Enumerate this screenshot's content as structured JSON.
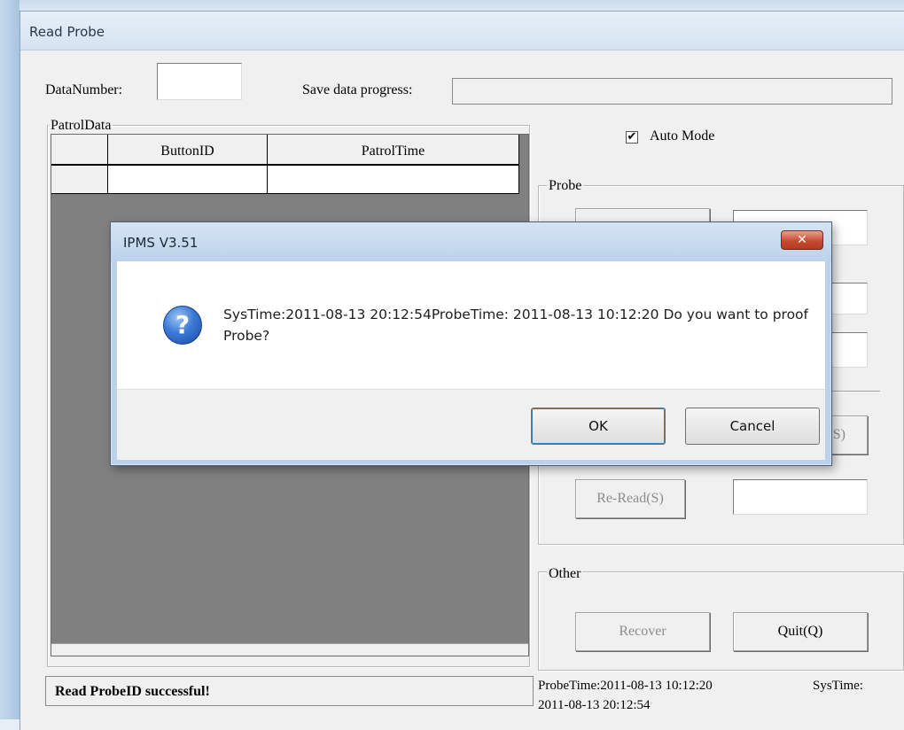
{
  "window": {
    "title": "Read Probe"
  },
  "fields": {
    "data_number_label": "DataNumber:",
    "data_number_value": "",
    "save_progress_label": "Save data progress:",
    "save_progress_value": 0
  },
  "patrol": {
    "group_label": "PatrolData",
    "columns": [
      "",
      "ButtonID",
      "PatrolTime"
    ],
    "rows": [
      [
        "",
        "",
        ""
      ]
    ]
  },
  "auto_mode": {
    "label": "Auto Mode",
    "checked": true,
    "check_glyph": "✔"
  },
  "probe": {
    "group_label": "Probe",
    "button_partial": "S)",
    "reread_label": "Re-Read(S)"
  },
  "other": {
    "group_label": "Other",
    "recover_label": "Recover",
    "quit_label": "Quit(Q)"
  },
  "status": {
    "message": "Read ProbeID successful!",
    "probe_time": "ProbeTime:2011-08-13 10:12:20",
    "sys_time_label": "SysTime:",
    "sys_time_value": "2011-08-13 20:12:54"
  },
  "dialog": {
    "title": "IPMS V3.51",
    "icon": "question-icon",
    "message": "SysTime:2011-08-13 20:12:54ProbeTime: 2011-08-13 10:12:20 Do you want to proof Probe?",
    "ok_label": "OK",
    "cancel_label": "Cancel",
    "close_glyph": "✕"
  }
}
